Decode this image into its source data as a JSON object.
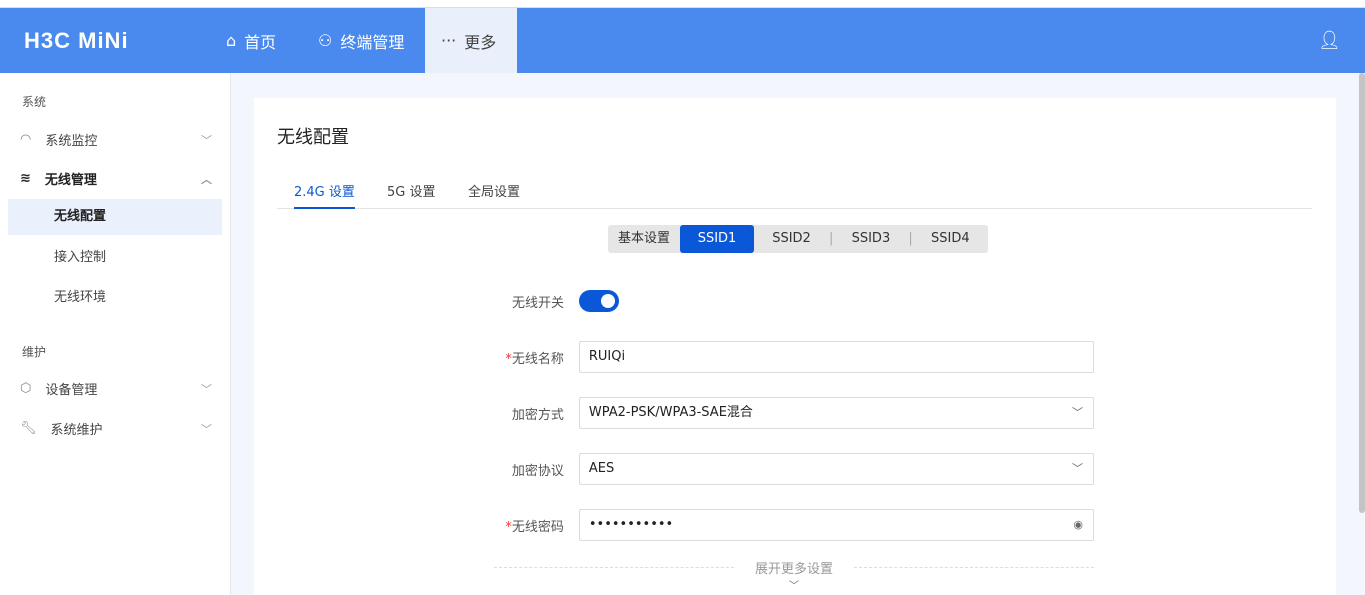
{
  "header": {
    "logo": "H3C MiNi",
    "nav": [
      {
        "icon": "home-icon",
        "label": "首页"
      },
      {
        "icon": "network-icon",
        "label": "终端管理"
      },
      {
        "icon": "more-icon",
        "label": "更多"
      }
    ]
  },
  "sidebar": {
    "sections": [
      {
        "title": "系统",
        "items": [
          {
            "label": "系统监控"
          },
          {
            "label": "无线管理",
            "subitems": [
              "无线配置",
              "接入控制",
              "无线环境"
            ]
          }
        ]
      },
      {
        "title": "维护",
        "items": [
          {
            "label": "设备管理"
          },
          {
            "label": "系统维护"
          }
        ]
      }
    ]
  },
  "main": {
    "title": "无线配置",
    "tabs": [
      "2.4G 设置",
      "5G 设置",
      "全局设置"
    ],
    "segments": [
      "基本设置",
      "SSID1",
      "SSID2",
      "SSID3",
      "SSID4"
    ],
    "form": {
      "switch_label": "无线开关",
      "switch_on": true,
      "name_label": "无线名称",
      "name_value": "RUIQi",
      "enc_label": "加密方式",
      "enc_value": "WPA2-PSK/WPA3-SAE混合",
      "proto_label": "加密协议",
      "proto_value": "AES",
      "pwd_label": "无线密码",
      "pwd_value": "•••••••••••",
      "expand": "展开更多设置"
    }
  }
}
